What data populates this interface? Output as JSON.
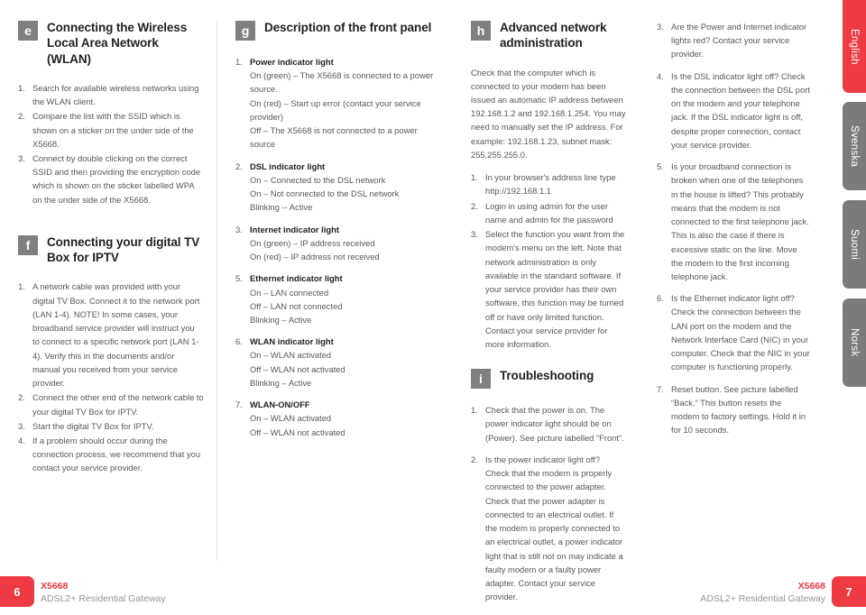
{
  "languages": [
    {
      "label": "English",
      "active": true,
      "color": "#ee3a43"
    },
    {
      "label": "Svenska",
      "active": false,
      "color": "#7b7b7d"
    },
    {
      "label": "Suomi",
      "active": false,
      "color": "#7b7b7d"
    },
    {
      "label": "Norsk",
      "active": false,
      "color": "#7b7b7d"
    }
  ],
  "sections": {
    "e": {
      "badge": "e",
      "title": "Connecting the Wireless Local Area Network (WLAN)",
      "items": [
        {
          "num": "1.",
          "text": "Search for available wireless networks using the WLAN client."
        },
        {
          "num": "2.",
          "text": "Compare the list with the SSID which is shown on a sticker on the under side of the X5668."
        },
        {
          "num": "3.",
          "text": "Connect by double clicking on the correct SSID and then providing the encryption code which is shown on the sticker labelled WPA on the under side of the X5668."
        }
      ]
    },
    "f": {
      "badge": "f",
      "title": "Connecting your digital TV Box for IPTV",
      "items": [
        {
          "num": "1.",
          "text": "A network cable was provided with your digital TV Box. Connect it to the network port (LAN 1-4). NOTE! In some cases, your broadband service provider will instruct you to connect to a specific network port (LAN 1-4). Verify this in the documents and/or manual you received from your service provider."
        },
        {
          "num": "2.",
          "text": "Connect the other end of the network cable to your digital TV Box for IPTV."
        },
        {
          "num": "3.",
          "text": "Start the digital TV Box for IPTV."
        },
        {
          "num": "4.",
          "text": "If a problem should occur during the connection process, we recommend that you contact your service provider."
        }
      ]
    },
    "g": {
      "badge": "g",
      "title": "Description of the front panel",
      "items": [
        {
          "num": "1.",
          "title": "Power indicator light",
          "lines": [
            "On (green) – The X5668 is connected to a power source.",
            "On (red) – Start up error (contact your service provider)",
            "Off – The X5668 is not connected to a power source"
          ]
        },
        {
          "num": "2.",
          "title": "DSL indicator light",
          "lines": [
            "On – Connected to the DSL network",
            "On – Not connected to the DSL network",
            "Blinking -- Active"
          ]
        },
        {
          "num": "3.",
          "title": "Internet indicator light",
          "lines": [
            "On (green) – IP address received",
            "On (red) – IP address not received"
          ]
        },
        {
          "num": "5.",
          "title": "Ethernet indicator light",
          "lines": [
            "On – LAN connected",
            "Off – LAN not connected",
            "Blinking – Active"
          ]
        },
        {
          "num": "6.",
          "title": "WLAN indicator light",
          "lines": [
            "On – WLAN activated",
            "Off – WLAN not activated",
            "Blinking – Active"
          ]
        },
        {
          "num": "7.",
          "title": "WLAN-ON/OFF",
          "lines": [
            "On – WLAN activated",
            "Off – WLAN not activated"
          ]
        }
      ]
    },
    "h": {
      "badge": "h",
      "title": "Advanced network administration",
      "intro": "Check that the computer which is connected to your modem has been issued an automatic IP address between 192.168.1.2 and 192.168.1.254. You may need to manually set the IP address. For example: 192.168.1.23, subnet mask: 255.255.255.0.",
      "items": [
        {
          "num": "1.",
          "text": "In your browser's address line type http://192.168.1.1"
        },
        {
          "num": "2.",
          "text": "Login in using admin for the user name and admin for the password"
        },
        {
          "num": "3.",
          "text": "Select the function you want from the modem's menu on the left. Note that network administration is only available in the standard software. If your service provider has their own software, this function may be turned off or have only limited function. Contact your service provider for more information."
        }
      ]
    },
    "i": {
      "badge": "i",
      "title": "Troubleshooting",
      "items_left": [
        {
          "num": "1.",
          "text": "Check that the power is on. The power indicator light should be on (Power). See picture labelled “Front”."
        },
        {
          "num": "2.",
          "text": "Is the power indicator light off? Check that the modem is properly connected to the power adapter.  Check that the power adapter is connected to an electrical outlet. If the modem is properly connected to an electrical outlet, a power indicator light that is still not on may indicate a faulty modem or a faulty power adapter. Contact your service provider."
        }
      ],
      "items_right": [
        {
          "num": "3.",
          "text": "Are the Power and Internet indicator lights red? Contact your service provider."
        },
        {
          "num": "4.",
          "text": "Is the DSL indicator light off? Check the connection between the DSL port on the modem and your telephone jack. If the DSL indicator light is off, despite proper connection, contact your service provider."
        },
        {
          "num": "5.",
          "text": "Is your broadband connection is broken when one of the telephones in the house is lifted? This probably means that the modem is not connected to the first telephone jack. This is also the case if there is excessive static on the line. Move the modem to the first incoming telephone jack."
        },
        {
          "num": "6.",
          "text": "Is the Ethernet indicator light off? Check the connection between the LAN port on the modem and the Network Interface Card (NIC) in your computer. Check that the NIC in your computer is functioning properly."
        },
        {
          "num": "7.",
          "text": "Reset button. See picture labelled “Back.” This button resets the modem to factory settings. Hold it in for 10 seconds."
        }
      ]
    }
  },
  "footer": {
    "left_page": "6",
    "right_page": "7",
    "model": "X5668",
    "model_sub": "ADSL2+ Residential Gateway",
    "accent": "#ee3a43"
  }
}
